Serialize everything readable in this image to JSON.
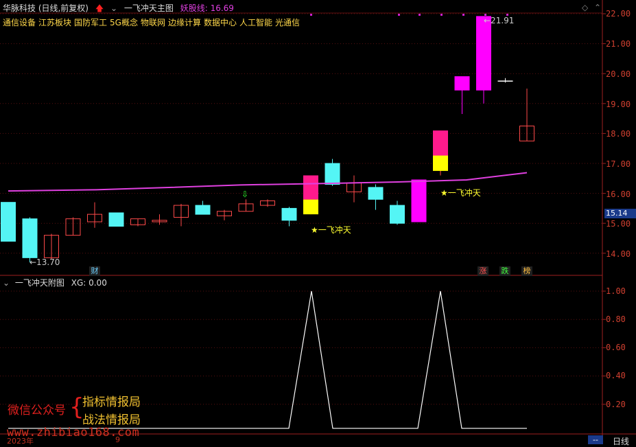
{
  "header": {
    "stock_label": "华脉科技 (日线,前复权)",
    "chart_title": "一飞冲天主图",
    "indicator_label": "妖股线: 16.69"
  },
  "concepts": [
    "通信设备",
    "江苏板块",
    "国防军工",
    "5G概念",
    "物联网",
    "边缘计算",
    "数据中心",
    "人工智能",
    "光通信"
  ],
  "sub_header": {
    "title": "一飞冲天附图",
    "value_label": "XG: 0.00"
  },
  "price_axis": [
    "22.00",
    "21.00",
    "20.00",
    "19.00",
    "18.00",
    "17.00",
    "16.00",
    "15.00",
    "14.00"
  ],
  "current_price": "15.14",
  "sub_axis": [
    "1.00",
    "0.80",
    "0.60",
    "0.40",
    "0.20"
  ],
  "annotations": {
    "low_price": "←13.70",
    "high_price": "←21.91",
    "signal_1": "★一飞冲天",
    "signal_2": "★一飞冲天",
    "fin_badge": "财",
    "up_badge": "涨",
    "down_badge": "跌",
    "rank_badge": "榜"
  },
  "bottom": {
    "year": "2023年",
    "month": "9",
    "period": "日线",
    "nav": "--"
  },
  "watermark": {
    "left": "微信公众号",
    "line1": "指标情报局",
    "line2": "战法情报局",
    "url": "www.zhibiao168.com"
  },
  "colors": {
    "up": "#ff4a4a",
    "down": "#54f5f5",
    "signal": "#ff00ff",
    "yellow": "#ffff00",
    "ma": "#e040e0"
  },
  "chart_data": {
    "type": "candlestick",
    "candles": [
      {
        "o": 15.7,
        "h": 15.7,
        "l": 14.4,
        "c": 14.4,
        "kind": "down"
      },
      {
        "o": 15.15,
        "h": 15.2,
        "l": 13.7,
        "c": 13.85,
        "kind": "down"
      },
      {
        "o": 13.85,
        "h": 14.65,
        "l": 13.8,
        "c": 14.6,
        "kind": "up"
      },
      {
        "o": 14.6,
        "h": 15.2,
        "l": 14.6,
        "c": 15.15,
        "kind": "up"
      },
      {
        "o": 15.05,
        "h": 15.7,
        "l": 14.85,
        "c": 15.3,
        "kind": "up"
      },
      {
        "o": 15.35,
        "h": 15.35,
        "l": 14.9,
        "c": 14.9,
        "kind": "down"
      },
      {
        "o": 14.95,
        "h": 15.15,
        "l": 14.9,
        "c": 15.15,
        "kind": "up"
      },
      {
        "o": 15.05,
        "h": 15.3,
        "l": 14.95,
        "c": 15.1,
        "kind": "up"
      },
      {
        "o": 15.2,
        "h": 15.65,
        "l": 14.9,
        "c": 15.6,
        "kind": "up"
      },
      {
        "o": 15.6,
        "h": 15.75,
        "l": 15.3,
        "c": 15.3,
        "kind": "down"
      },
      {
        "o": 15.25,
        "h": 15.45,
        "l": 15.1,
        "c": 15.4,
        "kind": "up"
      },
      {
        "o": 15.4,
        "h": 15.8,
        "l": 15.4,
        "c": 15.65,
        "kind": "up"
      },
      {
        "o": 15.6,
        "h": 15.8,
        "l": 15.55,
        "c": 15.75,
        "kind": "up"
      },
      {
        "o": 15.5,
        "h": 15.55,
        "l": 14.9,
        "c": 15.1,
        "kind": "down"
      },
      {
        "o": 15.3,
        "h": 16.6,
        "l": 15.3,
        "c": 16.6,
        "kind": "signal"
      },
      {
        "o": 17.0,
        "h": 17.15,
        "l": 16.25,
        "c": 16.3,
        "kind": "down"
      },
      {
        "o": 16.05,
        "h": 16.6,
        "l": 15.7,
        "c": 16.35,
        "kind": "up"
      },
      {
        "o": 16.2,
        "h": 16.3,
        "l": 15.45,
        "c": 15.8,
        "kind": "down"
      },
      {
        "o": 15.6,
        "h": 15.75,
        "l": 14.95,
        "c": 15.0,
        "kind": "down"
      },
      {
        "o": 15.05,
        "h": 16.45,
        "l": 15.05,
        "c": 16.45,
        "kind": "signal_solid"
      },
      {
        "o": 16.75,
        "h": 18.1,
        "l": 16.6,
        "c": 18.1,
        "kind": "signal"
      },
      {
        "o": 19.45,
        "h": 19.9,
        "l": 18.65,
        "c": 19.9,
        "kind": "signal_solid"
      },
      {
        "o": 19.45,
        "h": 21.91,
        "l": 19.0,
        "c": 21.91,
        "kind": "signal_solid"
      },
      {
        "o": 19.75,
        "h": 19.85,
        "l": 19.7,
        "c": 19.75,
        "kind": "flat"
      },
      {
        "o": 17.75,
        "h": 19.5,
        "l": 17.75,
        "c": 18.25,
        "kind": "up"
      }
    ],
    "ma_line": [
      16.08,
      16.12,
      16.2,
      16.28,
      16.33,
      16.38,
      16.45,
      16.69
    ],
    "xg_peaks": [
      14,
      20
    ],
    "ylim": [
      13.5,
      22.3
    ]
  }
}
